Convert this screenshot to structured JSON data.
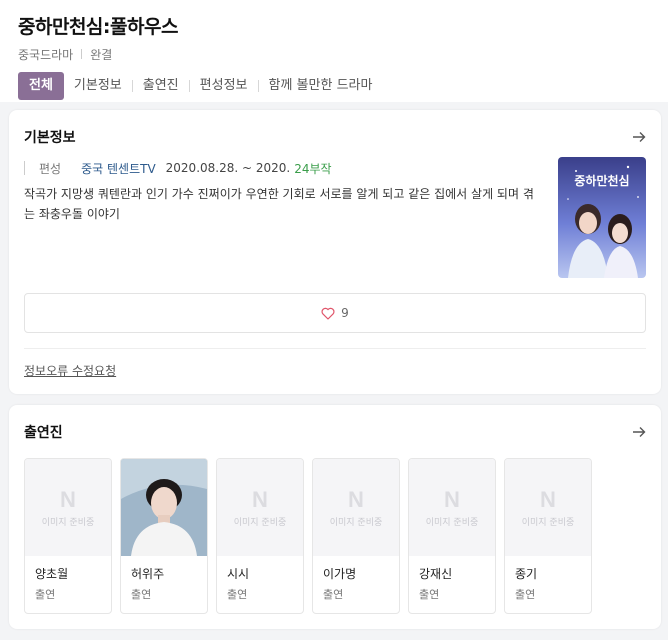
{
  "title": "중하만천심:풀하우스",
  "meta": {
    "genre": "중국드라마",
    "status": "완결"
  },
  "tabs": [
    "전체",
    "기본정보",
    "출연진",
    "편성정보",
    "함께 볼만한 드라마"
  ],
  "basic": {
    "heading": "기본정보",
    "label": "편성",
    "network": "중국 텐센트TV",
    "dates": "2020.08.28. ~ 2020.",
    "episodes": "24부작",
    "synopsis": "작곡가 지망생 쿼텐란과 인기 가수 진쩌이가 우연한 기회로 서로를 알게 되고 같은 집에서 살게 되며 겪는 좌충우돌 이야기",
    "poster_title": "중하만천심",
    "likes": "9",
    "report_link": "정보오류 수정요청"
  },
  "cast_section": {
    "heading": "출연진",
    "placeholder_logo": "N",
    "placeholder_text": "이미지 준비중",
    "members": [
      {
        "name": "양초월",
        "role": "출연",
        "has_photo": false
      },
      {
        "name": "허위주",
        "role": "출연",
        "has_photo": true
      },
      {
        "name": "시시",
        "role": "출연",
        "has_photo": false
      },
      {
        "name": "이가명",
        "role": "출연",
        "has_photo": false
      },
      {
        "name": "강재신",
        "role": "출연",
        "has_photo": false
      },
      {
        "name": "종기",
        "role": "출연",
        "has_photo": false
      }
    ]
  },
  "colors": {
    "accent": "#8a6f96",
    "network": "#2d5a8c",
    "episodes": "#3a9d4a"
  }
}
